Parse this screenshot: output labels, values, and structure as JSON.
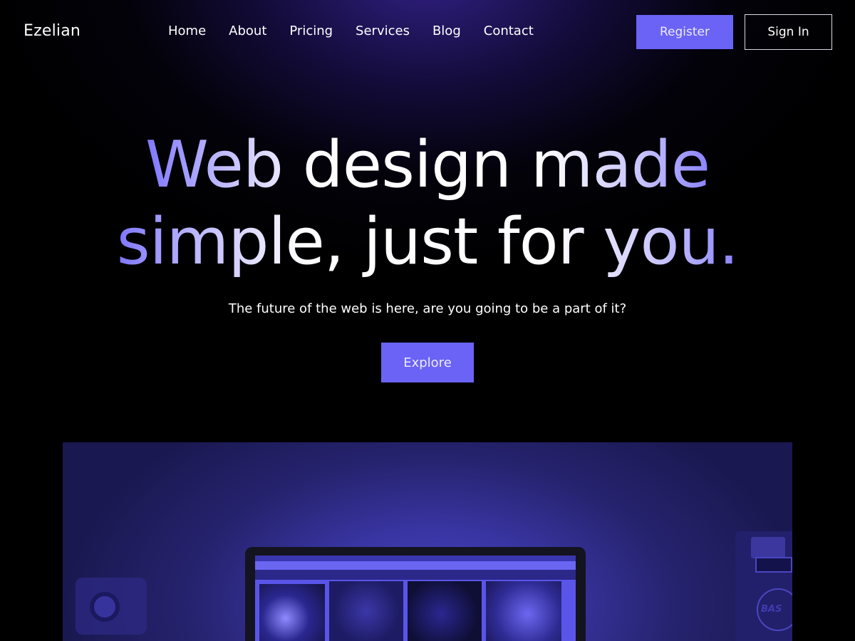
{
  "brand": {
    "name": "Ezelian"
  },
  "nav": {
    "items": [
      {
        "label": "Home"
      },
      {
        "label": "About"
      },
      {
        "label": "Pricing"
      },
      {
        "label": "Services"
      },
      {
        "label": "Blog"
      },
      {
        "label": "Contact"
      }
    ],
    "register_label": "Register",
    "signin_label": "Sign In"
  },
  "hero": {
    "title_line1": "Web design made",
    "title_line2": "simple, just for you.",
    "subtitle": "The future of the web is here, are you going to be a part of it?",
    "cta_label": "Explore"
  },
  "image": {
    "emblem_text": "BAS"
  },
  "colors": {
    "accent": "#6a63f5",
    "background": "#000000",
    "glow": "#34228c"
  }
}
